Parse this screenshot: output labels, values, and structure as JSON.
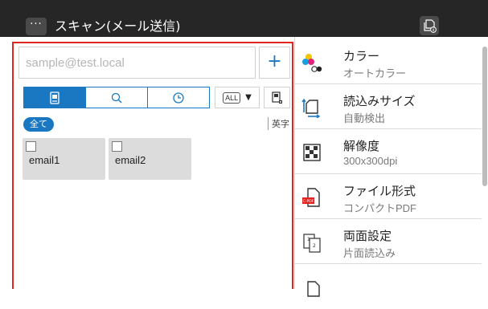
{
  "header": {
    "menu_label": "···",
    "title": "スキャン(メール送信)",
    "background": "#262626"
  },
  "address_panel": {
    "search": {
      "value": "",
      "placeholder": "sample@test.local"
    },
    "add_label": "+",
    "tabs": [
      {
        "icon": "address-book-icon",
        "active": true
      },
      {
        "icon": "search-icon",
        "active": false
      },
      {
        "icon": "history-clock-icon",
        "active": false
      }
    ],
    "filter": {
      "badge": "ALL",
      "arrow": "▼"
    },
    "index_all_label": "全て",
    "index_alpha_label": "英字",
    "emails": [
      {
        "label": "email1",
        "checked": false
      },
      {
        "label": "email2",
        "checked": false
      }
    ],
    "accent_color": "#1a78c2",
    "focus_border_color": "#e0241f"
  },
  "settings": [
    {
      "title": "カラー",
      "value": "オートカラー",
      "icon": "color-mode-icon"
    },
    {
      "title": "読込みサイズ",
      "value": "自動検出",
      "icon": "scan-size-icon"
    },
    {
      "title": "解像度",
      "value": "300x300dpi",
      "icon": "resolution-icon"
    },
    {
      "title": "ファイル形式",
      "value": "コンパクトPDF",
      "icon": "file-format-icon",
      "icon_badge": "C-PDF"
    },
    {
      "title": "両面設定",
      "value": "片面読込み",
      "icon": "duplex-icon"
    }
  ]
}
